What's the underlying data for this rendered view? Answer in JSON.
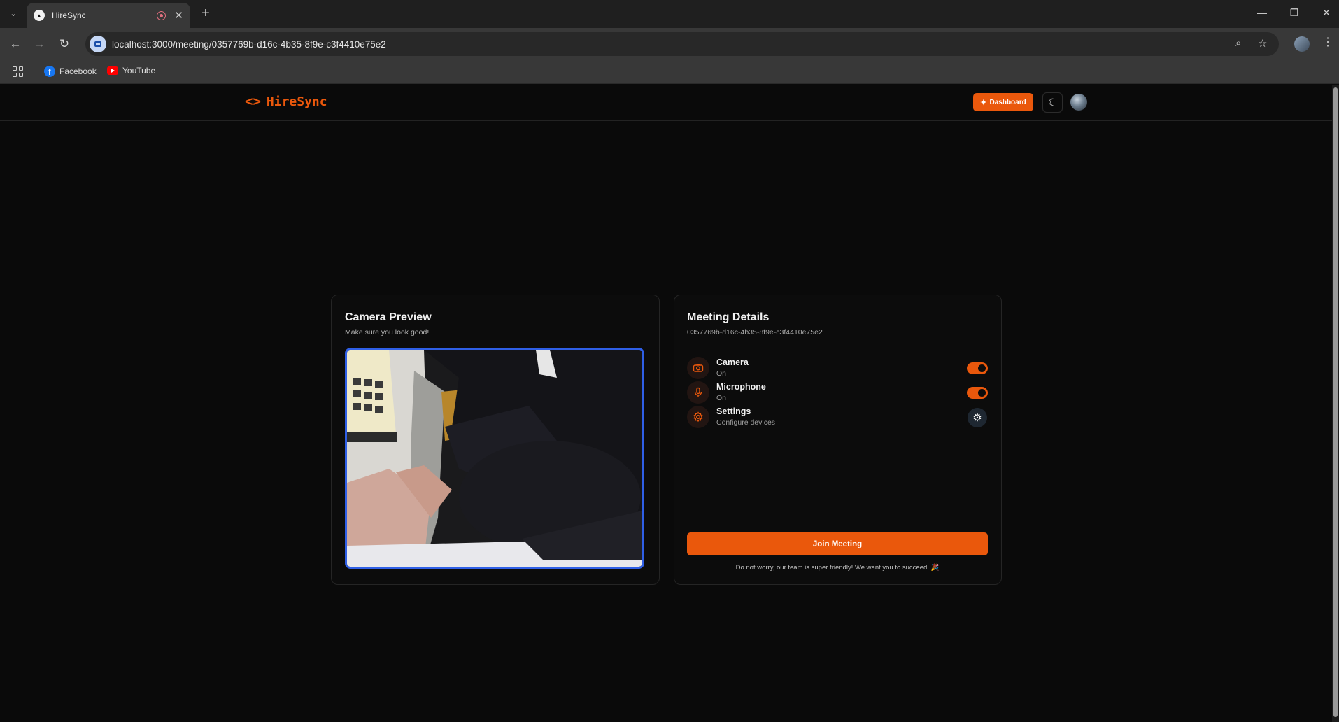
{
  "browser": {
    "tab_title": "HireSync",
    "url": "localhost:3000/meeting/0357769b-d16c-4b35-8f9e-c3f4410e75e2",
    "bookmarks": [
      {
        "label": "Facebook",
        "icon": "facebook-icon"
      },
      {
        "label": "YouTube",
        "icon": "youtube-icon"
      }
    ]
  },
  "header": {
    "logo_text": "HireSync",
    "dashboard_label": "Dashboard"
  },
  "camera_card": {
    "title": "Camera Preview",
    "subtitle": "Make sure you look good!"
  },
  "meeting_card": {
    "title": "Meeting Details",
    "meeting_id": "0357769b-d16c-4b35-8f9e-c3f4410e75e2",
    "devices": [
      {
        "label": "Camera",
        "status": "On",
        "icon": "camera-icon",
        "enabled": true
      },
      {
        "label": "Microphone",
        "status": "On",
        "icon": "microphone-icon",
        "enabled": true
      },
      {
        "label": "Settings",
        "status": "Configure devices",
        "icon": "settings-icon"
      }
    ],
    "join_label": "Join Meeting",
    "footnote": "Do not worry, our team is super friendly! We want you to succeed. 🎉"
  },
  "colors": {
    "accent": "#ea580c",
    "video_border": "#2f5fe6",
    "background": "#0a0a0a"
  }
}
